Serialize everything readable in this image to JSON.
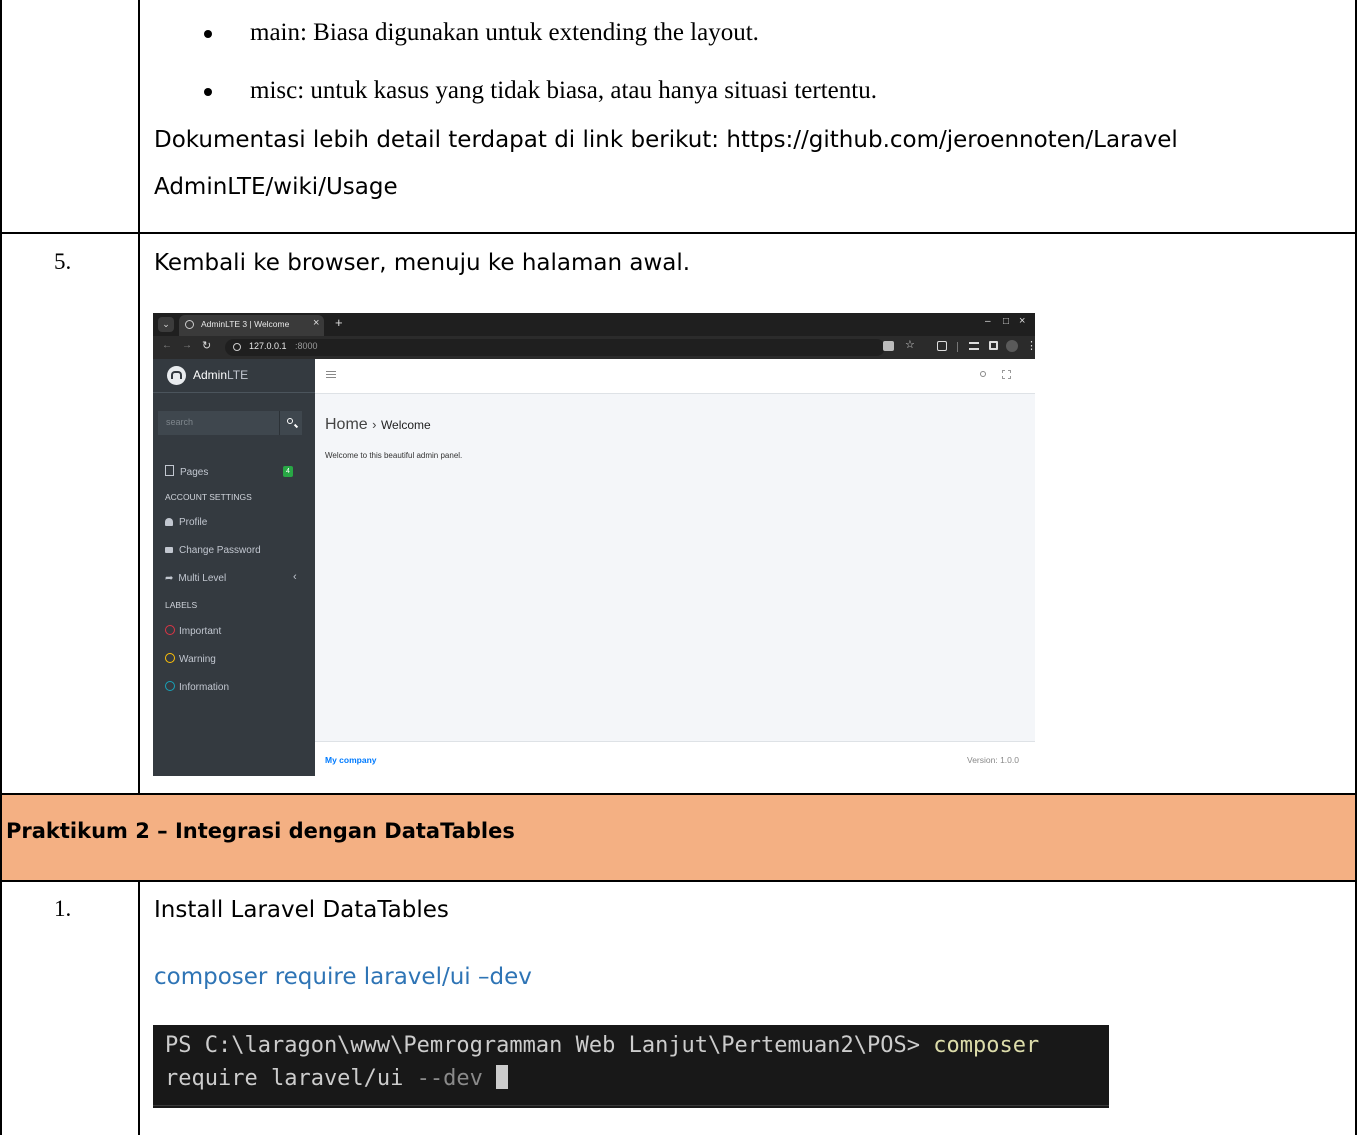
{
  "bullets": [
    "main: Biasa digunakan untuk extending the layout.",
    "misc: untuk kasus yang tidak biasa, atau hanya situasi tertentu."
  ],
  "docs_line1": "Dokumentasi lebih detail terdapat di link berikut: https://github.com/jeroennoten/Laravel",
  "docs_line2": "AdminLTE/wiki/Usage",
  "step5": {
    "number": "5.",
    "text": "Kembali ke browser, menuju ke halaman awal."
  },
  "screenshot": {
    "tab_title": "AdminLTE 3 | Welcome",
    "tab_close": "×",
    "tab_new": "+",
    "window_controls": [
      "–",
      "□",
      "×"
    ],
    "url_host": "127.0.0.1",
    "url_port": ":8000",
    "brand": "AdminLTE",
    "brand_prefix": "Admin",
    "brand_suffix": "LTE",
    "search_placeholder": "search",
    "pages_label": "Pages",
    "pages_badge": "4",
    "account_header": "ACCOUNT SETTINGS",
    "profile_label": "Profile",
    "password_label": "Change Password",
    "multilevel_label": "Multi Level",
    "labels_header": "LABELS",
    "label_items": [
      {
        "text": "Important",
        "color": "#dc3545"
      },
      {
        "text": "Warning",
        "color": "#ffc107"
      },
      {
        "text": "Information",
        "color": "#17a2b8"
      }
    ],
    "breadcrumb_home": "Home",
    "breadcrumb_sep": "›",
    "breadcrumb_page": "Welcome",
    "welcome_text": "Welcome to this beautiful admin panel.",
    "footer_company": "My company",
    "footer_version": "Version: 1.0.0"
  },
  "section_header": "Praktikum 2 – Integrasi dengan DataTables",
  "step1": {
    "number": "1.",
    "text": "Install Laravel DataTables"
  },
  "command_text": "composer require laravel/ui –dev",
  "terminal": {
    "prompt": "PS C:\\laragon\\www\\Pemrogramman Web Lanjut\\Pertemuan2\\POS>",
    "cmd": "composer",
    "line2_cmd": "require laravel/ui",
    "flag": "--dev"
  },
  "colors": {
    "section_bg": "#f4b083",
    "command_blue": "#2e74b5",
    "terminal_yellow": "#dcdcaa",
    "sidebar_bg": "#343a40",
    "footer_blue": "#007bff",
    "badge_green": "#28a745"
  }
}
